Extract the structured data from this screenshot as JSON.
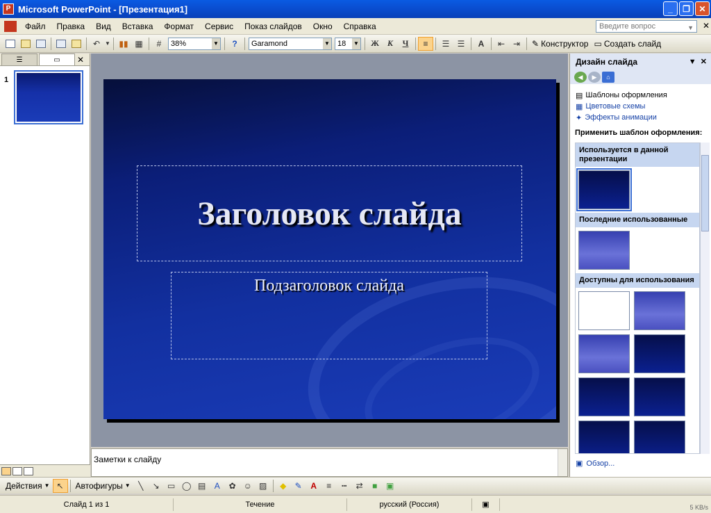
{
  "window": {
    "app_title": "Microsoft PowerPoint - [Презентация1]"
  },
  "menu": {
    "items": [
      "Файл",
      "Правка",
      "Вид",
      "Вставка",
      "Формат",
      "Сервис",
      "Показ слайдов",
      "Окно",
      "Справка"
    ],
    "help_placeholder": "Введите вопрос"
  },
  "toolbar": {
    "zoom": "38%",
    "font": "Garamond",
    "font_size": "18",
    "bold_label": "Ж",
    "italic_label": "К",
    "underline_label": "Ч",
    "designer_label": "Конструктор",
    "new_slide_label": "Создать слайд"
  },
  "slides_pane": {
    "slide_number": "1"
  },
  "slide": {
    "title": "Заголовок слайда",
    "subtitle": "Подзаголовок слайда"
  },
  "notes": {
    "placeholder": "Заметки к слайду"
  },
  "task_pane": {
    "title": "Дизайн слайда",
    "links": [
      "Шаблоны оформления",
      "Цветовые схемы",
      "Эффекты анимации"
    ],
    "apply_label": "Применить шаблон оформления:",
    "groups": [
      "Используется в данной презентации",
      "Последние использованные",
      "Доступны для использования"
    ],
    "browse": "Обзор..."
  },
  "drawing_toolbar": {
    "actions_label": "Действия",
    "autoshapes_label": "Автофигуры"
  },
  "status": {
    "slide": "Слайд 1 из 1",
    "design": "Течение",
    "language": "русский (Россия)",
    "net_speed": "5 KB/s"
  }
}
